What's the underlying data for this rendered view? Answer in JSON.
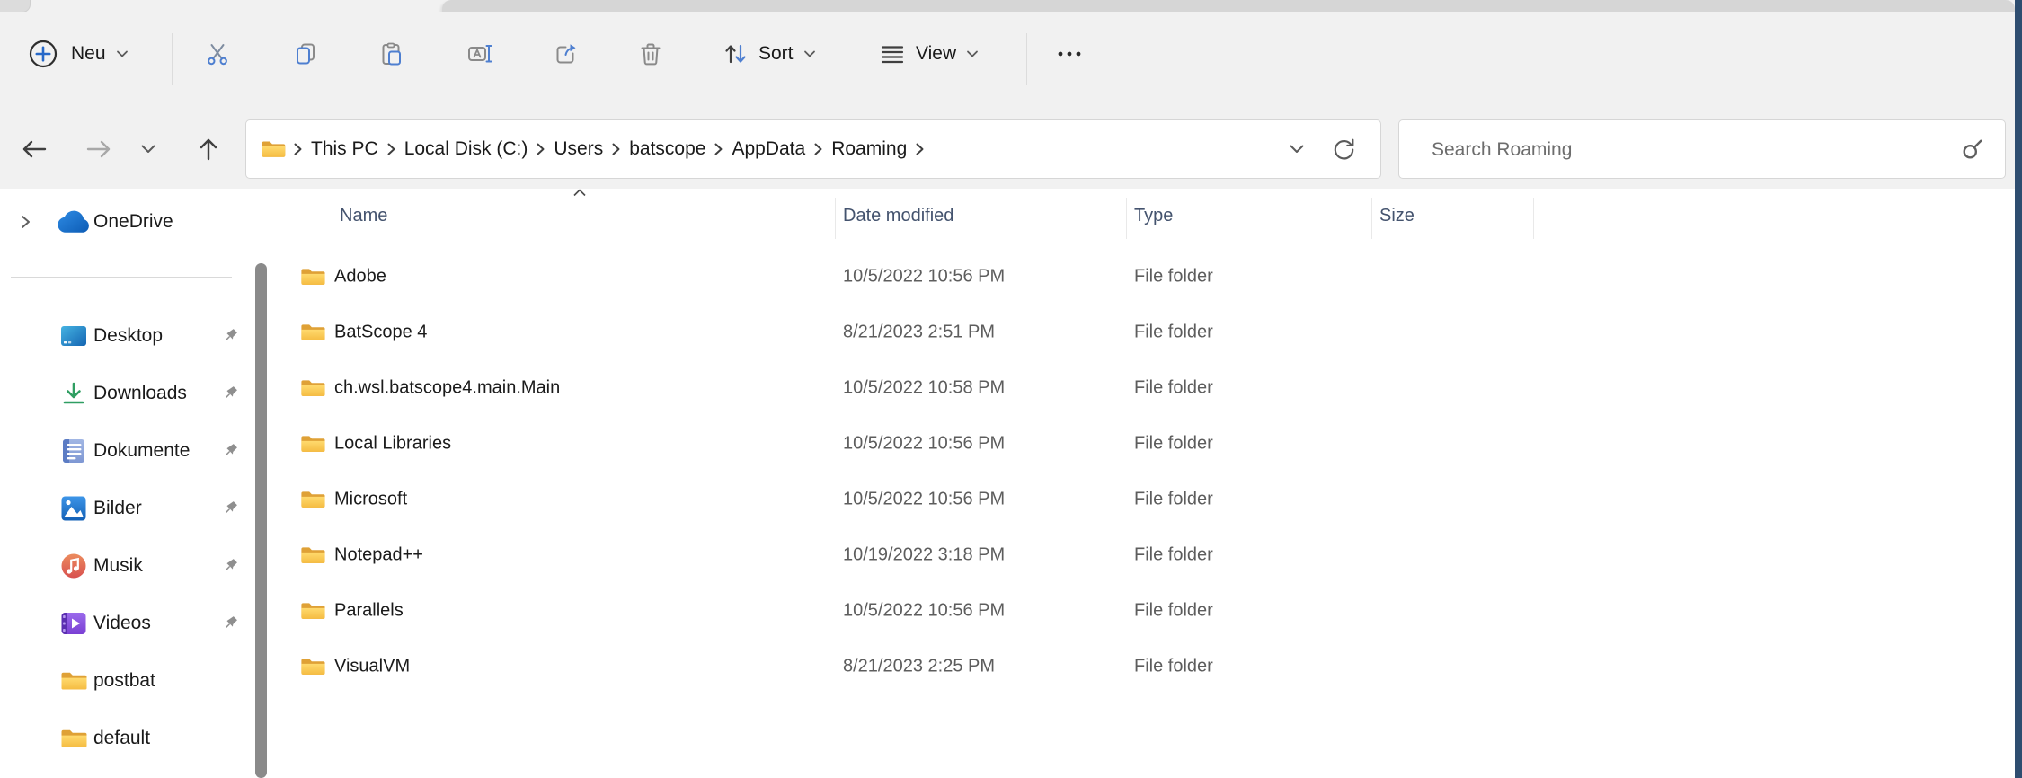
{
  "toolbar": {
    "new_label": "Neu",
    "sort_label": "Sort",
    "view_label": "View"
  },
  "navigation": {
    "breadcrumb": [
      "This PC",
      "Local Disk (C:)",
      "Users",
      "batscope",
      "AppData",
      "Roaming"
    ],
    "search_placeholder": "Search Roaming"
  },
  "sidebar": {
    "onedrive": {
      "label": "OneDrive",
      "icon": "onedrive-cloud-icon"
    },
    "items": [
      {
        "label": "Desktop",
        "icon": "desktop-icon",
        "pinned": true
      },
      {
        "label": "Downloads",
        "icon": "downloads-icon",
        "pinned": true
      },
      {
        "label": "Dokumente",
        "icon": "documents-icon",
        "pinned": true
      },
      {
        "label": "Bilder",
        "icon": "pictures-icon",
        "pinned": true
      },
      {
        "label": "Musik",
        "icon": "music-icon",
        "pinned": true
      },
      {
        "label": "Videos",
        "icon": "videos-icon",
        "pinned": true
      },
      {
        "label": "postbat",
        "icon": "folder-icon",
        "pinned": false
      },
      {
        "label": "default",
        "icon": "folder-icon",
        "pinned": false
      }
    ]
  },
  "file_list": {
    "columns": [
      "Name",
      "Date modified",
      "Type",
      "Size"
    ],
    "sorted_by": "Name",
    "sort_direction": "ascending",
    "rows": [
      {
        "name": "Adobe",
        "date_modified": "10/5/2022 10:56 PM",
        "type": "File folder",
        "size": ""
      },
      {
        "name": "BatScope 4",
        "date_modified": "8/21/2023 2:51 PM",
        "type": "File folder",
        "size": ""
      },
      {
        "name": "ch.wsl.batscope4.main.Main",
        "date_modified": "10/5/2022 10:58 PM",
        "type": "File folder",
        "size": ""
      },
      {
        "name": "Local Libraries",
        "date_modified": "10/5/2022 10:56 PM",
        "type": "File folder",
        "size": ""
      },
      {
        "name": "Microsoft",
        "date_modified": "10/5/2022 10:56 PM",
        "type": "File folder",
        "size": ""
      },
      {
        "name": "Notepad++",
        "date_modified": "10/19/2022 3:18 PM",
        "type": "File folder",
        "size": ""
      },
      {
        "name": "Parallels",
        "date_modified": "10/5/2022 10:56 PM",
        "type": "File folder",
        "size": ""
      },
      {
        "name": "VisualVM",
        "date_modified": "8/21/2023 2:25 PM",
        "type": "File folder",
        "size": ""
      }
    ]
  },
  "colors": {
    "accent_blue": "#4e7fd0",
    "toolbar_bg": "#f1f1f1",
    "header_text": "#44536e",
    "secondary_text": "#5d5d5d",
    "folder_front": "#ffd96e",
    "folder_back": "#dfa136",
    "scrollbar_thumb": "#8a8a8a",
    "right_edge_strip": "#2e4d70"
  }
}
